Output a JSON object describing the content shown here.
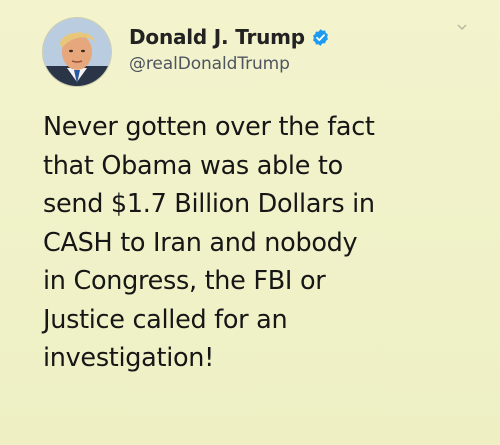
{
  "tweet": {
    "author": {
      "display_name": "Donald J. Trump",
      "handle": "@realDonaldTrump",
      "verified": true,
      "avatar_icon": "profile-photo"
    },
    "text_lines": [
      "Never gotten over the fact",
      "that Obama was able to",
      "send $1.7 Billion Dollars in",
      "CASH to Iran and nobody",
      "in Congress, the FBI or",
      "Justice called for an",
      "investigation!"
    ],
    "menu_icon": "chevron-down-icon"
  },
  "colors": {
    "background": "#f1f1c8",
    "verified_badge": "#1d9bf0",
    "text": "#161616",
    "handle": "#4e5560"
  }
}
